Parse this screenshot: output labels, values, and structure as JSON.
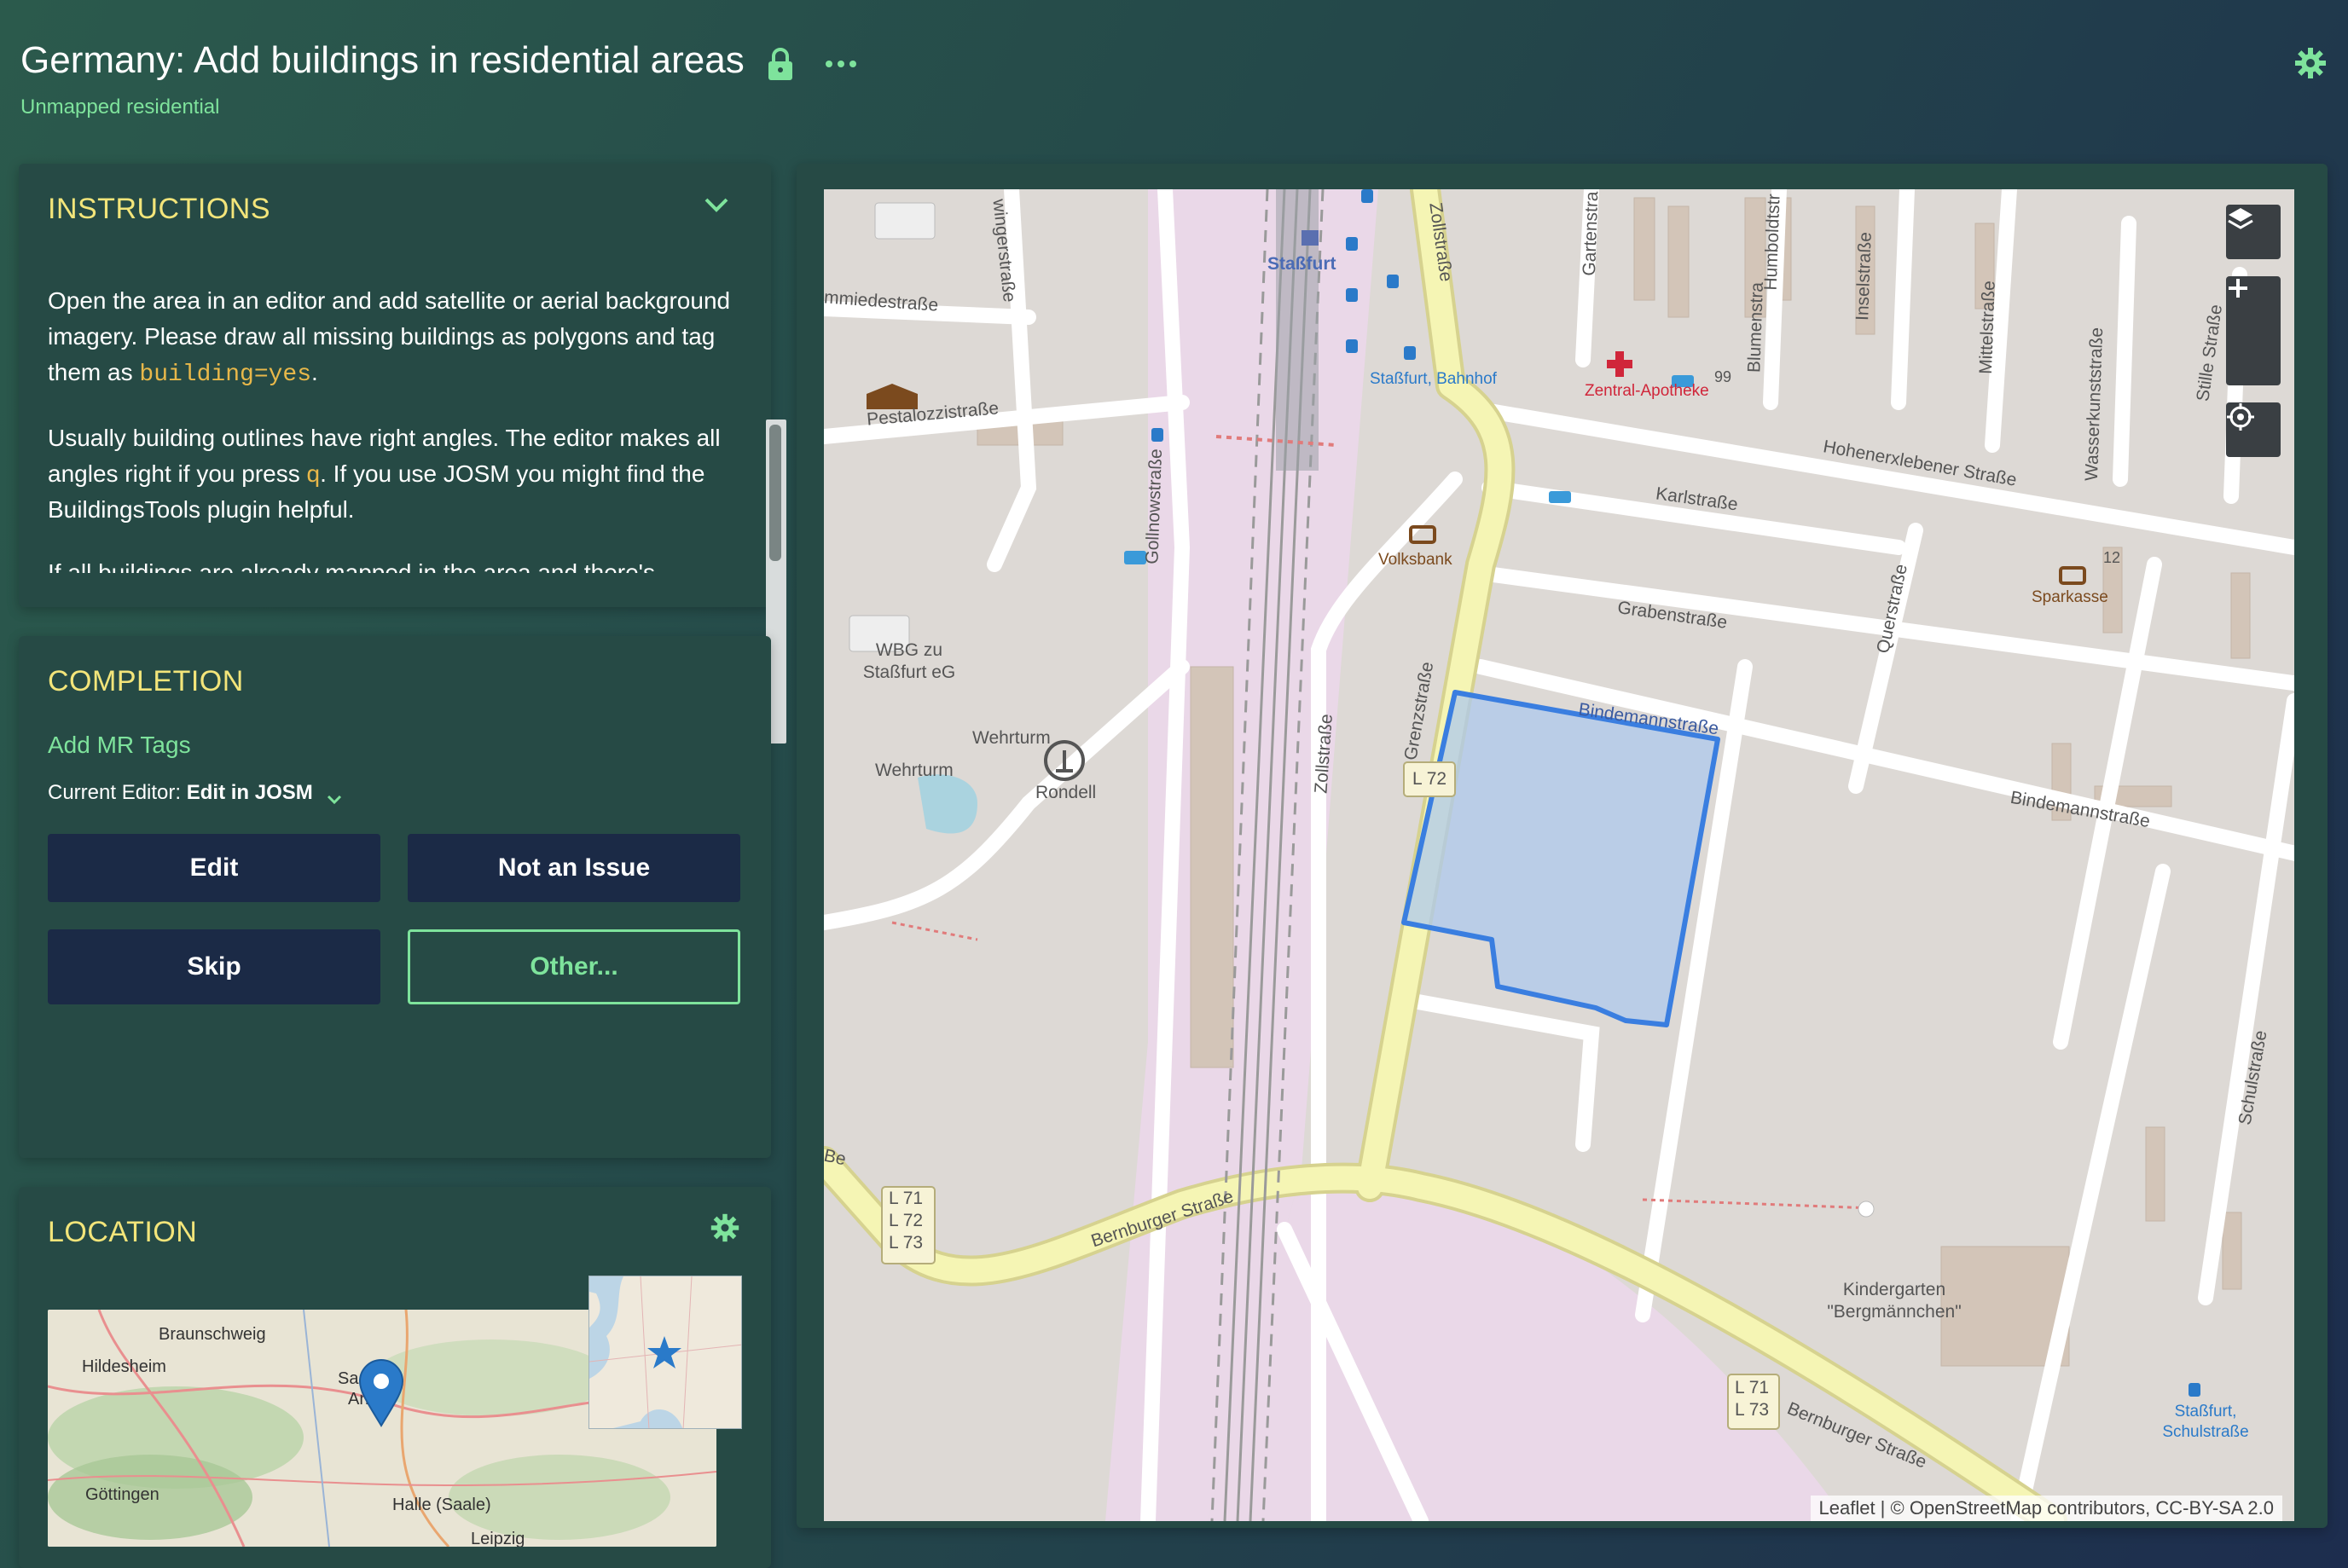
{
  "header": {
    "title": "Germany: Add buildings in residential areas",
    "subtitle": "Unmapped residential"
  },
  "instructions": {
    "title": "INSTRUCTIONS",
    "p1_before": "Open the area in an editor and add satellite or aerial background imagery. Please draw all missing buildings as polygons and tag them as ",
    "p1_code": "building=yes",
    "p1_after": ".",
    "p2_before": "Usually building outlines have right angles. The editor makes all angles right if you press ",
    "p2_key": "q",
    "p2_after": ". If you use JOSM you might find the BuildingsTools plugin helpful.",
    "p3": "If all buildings are already mapped in the area and there's"
  },
  "completion": {
    "title": "COMPLETION",
    "add_tags": "Add MR Tags",
    "editor_label": "Current Editor:",
    "editor_value": "Edit in JOSM",
    "buttons": {
      "edit": "Edit",
      "not_issue": "Not an Issue",
      "skip": "Skip",
      "other": "Other..."
    }
  },
  "location": {
    "title": "LOCATION",
    "minimap_labels": {
      "braunschweig": "Braunschweig",
      "hildesheim": "Hildesheim",
      "sa": "Sa",
      "an": "An",
      "goettingen": "Göttingen",
      "halle": "Halle (Saale)",
      "leipzig": "Leipzig"
    }
  },
  "map": {
    "labels": {
      "strassfurt": "Staßfurt",
      "mmiedestrasse": "mmiedestraße",
      "wingerstrasse": "wingerstraße",
      "pestalozzistrasse": "Pestalozzistraße",
      "gollnowstrasse": "Gollnowstraße",
      "zollstrasse_top": "Zollstraße",
      "gartenstrasse": "Gartenstra",
      "humboldtstr": "Humboldtstr",
      "blumenstra": "Blumenstra",
      "inselstrasse": "Inselstraße",
      "mittelstrasse": "Mittelstraße",
      "wasserkunststrasse": "Wasserkunststraße",
      "stille_strasse": "Stille Straße",
      "strassfurt_bahnhof": "Staßfurt, Bahnhof",
      "zentral_apotheke": "Zentral-Apotheke",
      "hohenerxlebener": "Hohenerxlebener Straße",
      "karlstrasse": "Karlstraße",
      "volksbank": "Volksbank",
      "grabenstrasse": "Grabenstraße",
      "querstrasse": "Querstraße",
      "sparkasse": "Sparkasse",
      "num12": "12",
      "num99": "99",
      "wbg": "WBG zu Staßfurt eG",
      "wehrturm1": "Wehrturm",
      "wehrturm2": "Wehrturm",
      "rondell": "Rondell",
      "bindemannstrasse1": "Bindemannstraße",
      "bindemannstrasse2": "Bindemannstraße",
      "zollstrasse_mid": "Zollstraße",
      "grenzstrasse": "Grenzstraße",
      "l72": "L 72",
      "l71_left": "L 71",
      "l72_left": "L 72",
      "l73_left": "L 73",
      "l71_right": "L 71",
      "l73_right": "L 73",
      "bernburger1": "Bernburger Straße",
      "bernburger2": "Bernburger Straße",
      "kindergarten": "Kindergarten \"Bergmännchen\"",
      "schulstrasse": "Schulstraße",
      "strassfurt_schulstrasse": "Staßfurt, Schulstraße",
      "be": "Be"
    },
    "attribution": "Leaflet | © OpenStreetMap contributors, CC-BY-SA 2.0",
    "colors": {
      "primary_road": "#f5f5b4",
      "road_edge": "#d6d28f",
      "railway_area": "#ead8e8",
      "task_polygon": "#3a7ee0",
      "task_fill": "#aec8ec"
    }
  },
  "colors": {
    "accent_green": "#7ee39c",
    "heading_yellow": "#f3e57a",
    "button_navy": "#1b2a46",
    "panel": "#264a45"
  }
}
